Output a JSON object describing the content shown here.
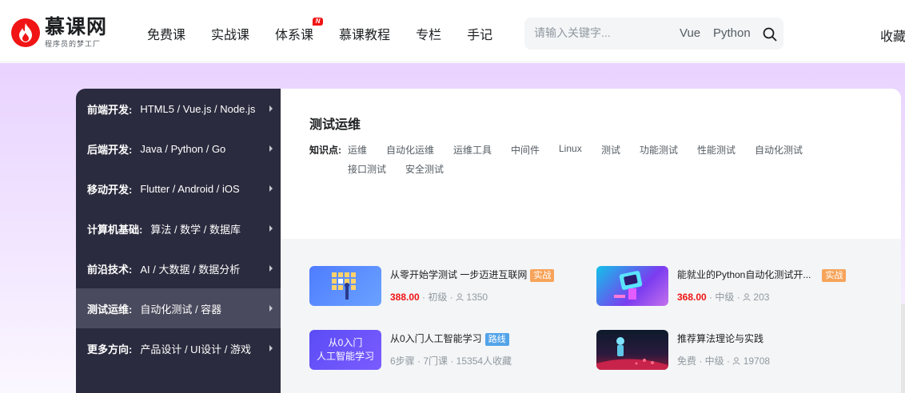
{
  "header": {
    "logo_name": "慕课网",
    "logo_slogan": "程序员的梦工厂",
    "nav": [
      {
        "label": "免费课"
      },
      {
        "label": "实战课"
      },
      {
        "label": "体系课",
        "badge": "N"
      },
      {
        "label": "慕课教程"
      },
      {
        "label": "专栏"
      },
      {
        "label": "手记"
      }
    ],
    "search_placeholder": "请输入关键字...",
    "hot_words": [
      "Vue",
      "Python"
    ],
    "favorites_label": "收藏"
  },
  "menu": [
    {
      "category": "前端开发:",
      "topics": "HTML5 / Vue.js / Node.js"
    },
    {
      "category": "后端开发:",
      "topics": "Java / Python / Go"
    },
    {
      "category": "移动开发:",
      "topics": "Flutter / Android / iOS"
    },
    {
      "category": "计算机基础:",
      "topics": "算法 / 数学 / 数据库"
    },
    {
      "category": "前沿技术:",
      "topics": "AI / 大数据 / 数据分析"
    },
    {
      "category": "测试运维:",
      "topics": "自动化测试 / 容器",
      "active": true
    },
    {
      "category": "更多方向:",
      "topics": "产品设计 / UI设计 / 游戏"
    }
  ],
  "panel": {
    "title": "测试运维",
    "knowledge_label": "知识点:",
    "knowledge_tags": [
      "运维",
      "自动化运维",
      "运维工具",
      "中间件",
      "Linux",
      "测试",
      "功能测试",
      "性能测试",
      "自动化测试",
      "接口测试",
      "安全测试"
    ]
  },
  "courses": [
    {
      "title": "从零开始学测试 一步迈进互联网",
      "tag": "实战",
      "tag_color": "#f7a45b",
      "price": "388.00",
      "meta": "· 初级 ·",
      "students": "1350",
      "thumb_text": ""
    },
    {
      "title": "能就业的Python自动化测试开...",
      "tag": "实战",
      "tag_color": "#f7a45b",
      "price": "368.00",
      "meta": "· 中级 ·",
      "students": "203",
      "thumb_text": ""
    },
    {
      "title": "从0入门人工智能学习",
      "tag": "路线",
      "tag_color": "#53a3e9",
      "price": "",
      "meta": "6步骤 · 7门课 · 15354人收藏",
      "students": "",
      "thumb_text": "从0入门\n人工智能学习"
    },
    {
      "title": "推荐算法理论与实践",
      "tag": "",
      "tag_color": "",
      "price": "",
      "meta": "免费 · 中级 ·",
      "students": "19708",
      "thumb_text": ""
    }
  ]
}
